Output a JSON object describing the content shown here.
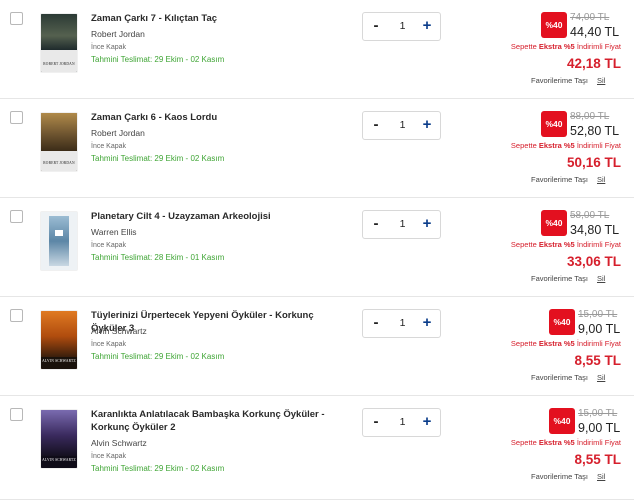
{
  "cart": {
    "items": [
      {
        "title": "Zaman Çarkı 7 - Kılıçtan Taç",
        "author": "Robert Jordan",
        "binding": "İnce Kapak",
        "delivery": "Tahmini Teslimat: 29 Ekim - 02 Kasım",
        "quantity": "1",
        "discount_badge": "%40",
        "old_price": "74,00 TL",
        "new_price": "44,40 TL",
        "campaign_prefix": "Sepette ",
        "campaign_bold": "Ekstra %5",
        "campaign_suffix": " İndirimli Fiyat",
        "final_price": "42,18 TL",
        "favorite_label": "Favorilerime Taşı",
        "delete_label": "Sil",
        "cover_caption": "ROBERT JORDAN",
        "cover_colors": [
          "#1e2a2c",
          "#3d4a43",
          "#e8e8e8"
        ]
      },
      {
        "title": "Zaman Çarkı 6 - Kaos Lordu",
        "author": "Robert Jordan",
        "binding": "İnce Kapak",
        "delivery": "Tahmini Teslimat: 29 Ekim - 02 Kasım",
        "quantity": "1",
        "discount_badge": "%40",
        "old_price": "88,00 TL",
        "new_price": "52,80 TL",
        "campaign_prefix": "Sepette ",
        "campaign_bold": "Ekstra %5",
        "campaign_suffix": " İndirimli Fiyat",
        "final_price": "50,16 TL",
        "favorite_label": "Favorilerime Taşı",
        "delete_label": "Sil",
        "cover_caption": "ROBERT JORDAN",
        "cover_colors": [
          "#4a3b22",
          "#8a6a36",
          "#e8e8e8"
        ]
      },
      {
        "title": "Planetary Cilt 4 - Uzayzaman Arkeolojisi",
        "author": "Warren Ellis",
        "binding": "İnce Kapak",
        "delivery": "Tahmini Teslimat: 28 Ekim - 01 Kasım",
        "quantity": "1",
        "discount_badge": "%40",
        "old_price": "58,00 TL",
        "new_price": "34,80 TL",
        "campaign_prefix": "Sepette ",
        "campaign_bold": "Ekstra %5",
        "campaign_suffix": " İndirimli Fiyat",
        "final_price": "33,06 TL",
        "favorite_label": "Favorilerime Taşı",
        "delete_label": "Sil",
        "cover_caption": "",
        "cover_colors": [
          "#eef2f5",
          "#7fa7c4",
          "#f5f5f5"
        ]
      },
      {
        "title": "Tüylerinizi Ürpertecek Yepyeni Öyküler - Korkunç Öyküler 3",
        "author": "Alvin Schwartz",
        "binding": "İnce Kapak",
        "delivery": "Tahmini Teslimat: 29 Ekim - 02 Kasım",
        "quantity": "1",
        "discount_badge": "%40",
        "old_price": "15,00 TL",
        "new_price": "9,00 TL",
        "campaign_prefix": "Sepette ",
        "campaign_bold": "Ekstra %5",
        "campaign_suffix": " İndirimli Fiyat",
        "final_price": "8,55 TL",
        "favorite_label": "Favorilerime Taşı",
        "delete_label": "Sil",
        "cover_caption": "ALVIN SCHWARTZ",
        "cover_colors": [
          "#c75a12",
          "#2a1a10",
          "#f2c26a"
        ]
      },
      {
        "title": "Karanlıkta Anlatılacak Bambaşka Korkunç Öyküler - Korkunç Öyküler 2",
        "author": "Alvin Schwartz",
        "binding": "İnce Kapak",
        "delivery": "Tahmini Teslimat: 29 Ekim - 02 Kasım",
        "quantity": "1",
        "discount_badge": "%40",
        "old_price": "15,00 TL",
        "new_price": "9,00 TL",
        "campaign_prefix": "Sepette ",
        "campaign_bold": "Ekstra %5",
        "campaign_suffix": " İndirimli Fiyat",
        "final_price": "8,55 TL",
        "favorite_label": "Favorilerime Taşı",
        "delete_label": "Sil",
        "cover_caption": "ALVIN SCHWARTZ",
        "cover_colors": [
          "#3a2a5e",
          "#12101c",
          "#c9c2e8"
        ]
      }
    ],
    "stepper": {
      "minus": "-",
      "plus": "+"
    },
    "colors": {
      "discount_red": "#e3101f",
      "price_red": "#d61f2c",
      "delivery_green": "#3fa535",
      "plus_blue": "#0a3c8a"
    },
    "icons": [
      "checkbox-icon",
      "minus-icon",
      "plus-icon"
    ]
  }
}
